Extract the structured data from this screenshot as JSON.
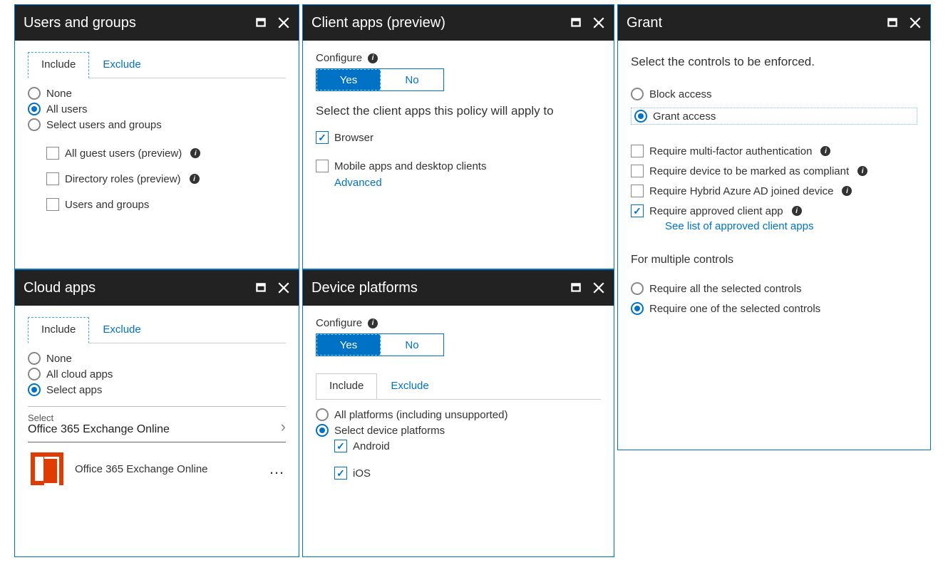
{
  "panels": {
    "usersGroups": {
      "title": "Users and groups",
      "tabs": {
        "include": "Include",
        "exclude": "Exclude"
      },
      "radios": {
        "none": "None",
        "allUsers": "All users",
        "selectUsers": "Select users and groups"
      },
      "checks": {
        "guest": "All guest users (preview)",
        "dirRoles": "Directory roles (preview)",
        "usersGroups": "Users and groups"
      }
    },
    "cloudApps": {
      "title": "Cloud apps",
      "tabs": {
        "include": "Include",
        "exclude": "Exclude"
      },
      "radios": {
        "none": "None",
        "allCloud": "All cloud apps",
        "selectApps": "Select apps"
      },
      "select": {
        "label": "Select",
        "value": "Office 365 Exchange Online"
      },
      "appItem": "Office 365 Exchange Online"
    },
    "clientApps": {
      "title": "Client apps (preview)",
      "configureLabel": "Configure",
      "toggle": {
        "yes": "Yes",
        "no": "No"
      },
      "heading": "Select the client apps this policy will apply to",
      "checks": {
        "browser": "Browser",
        "mobile": "Mobile apps and desktop clients"
      },
      "advanced": "Advanced"
    },
    "devicePlatforms": {
      "title": "Device platforms",
      "configureLabel": "Configure",
      "toggle": {
        "yes": "Yes",
        "no": "No"
      },
      "tabs": {
        "include": "Include",
        "exclude": "Exclude"
      },
      "radios": {
        "all": "All platforms (including unsupported)",
        "select": "Select device platforms"
      },
      "checks": {
        "android": "Android",
        "ios": "iOS"
      }
    },
    "grant": {
      "title": "Grant",
      "heading": "Select the controls to be enforced.",
      "radios": {
        "block": "Block access",
        "grant": "Grant access"
      },
      "checks": {
        "mfa": "Require multi-factor authentication",
        "compliant": "Require device to be marked as compliant",
        "hybrid": "Require Hybrid Azure AD joined device",
        "approved": "Require approved client app"
      },
      "approvedLink": "See list of approved client apps",
      "multiHeading": "For multiple controls",
      "multiRadios": {
        "all": "Require all the selected controls",
        "one": "Require one of the selected controls"
      }
    }
  }
}
